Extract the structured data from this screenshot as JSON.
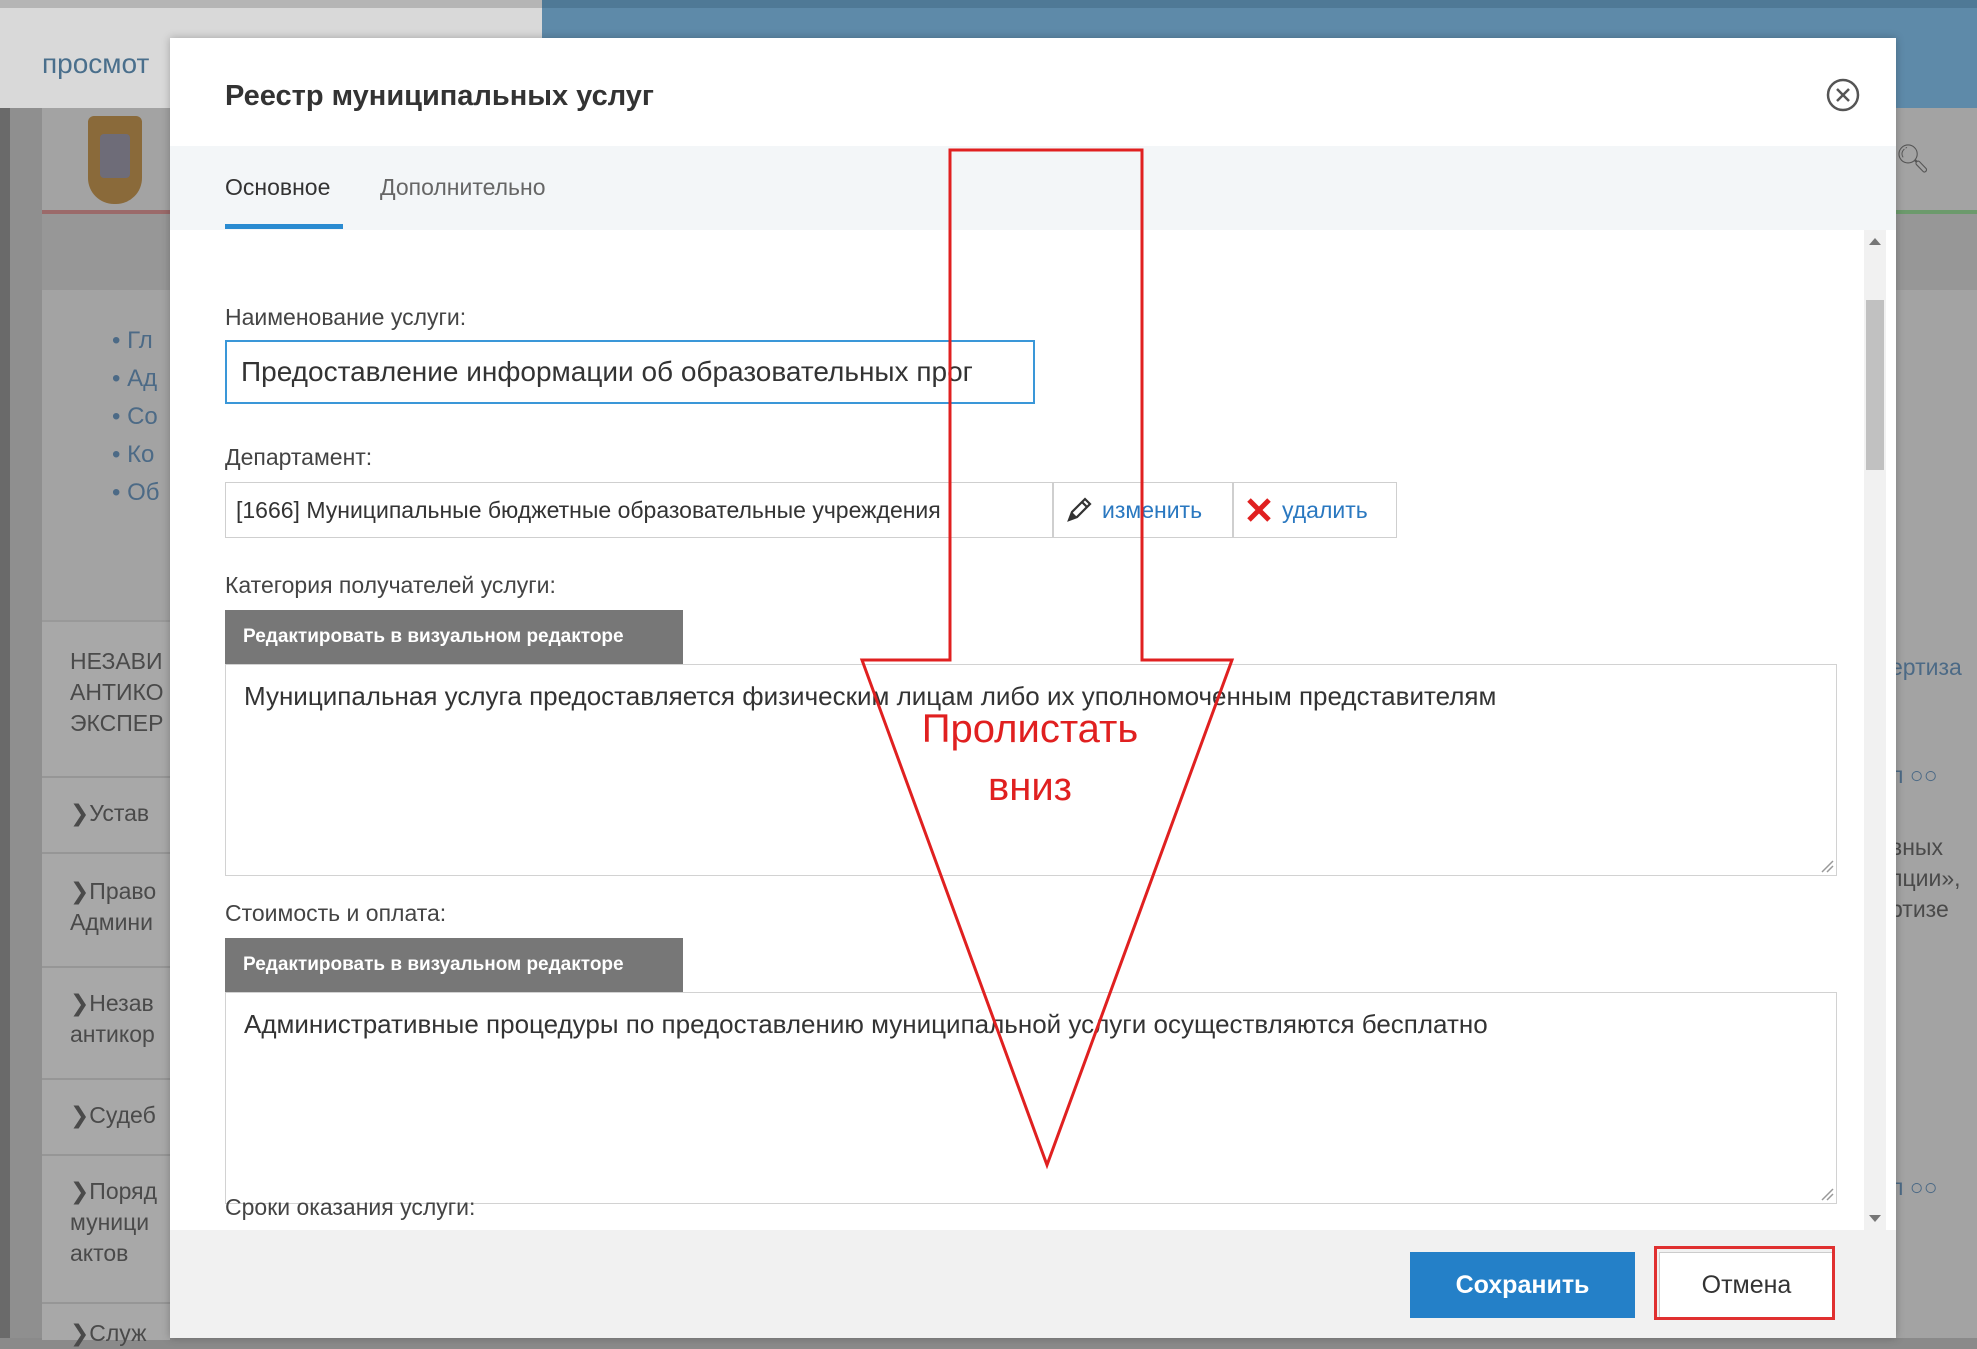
{
  "background": {
    "topbar_text": "просмот",
    "left_bullets": [
      "Гл",
      "Ад",
      "Со",
      "Ко",
      "Об"
    ],
    "left_panel_heading": [
      "НЕЗАВИ",
      "АНТИКО",
      "ЭКСПЕР"
    ],
    "left_items": [
      "Устав",
      "Право",
      "Админи",
      "Незав",
      "антикор",
      "Судеб",
      "Поряд",
      "муници",
      "актов",
      "Служ"
    ],
    "right_texts": {
      "heading": "ертиза",
      "toolbar1": "л  ○○",
      "lines": [
        "вных",
        "пции»,",
        "ртизе"
      ],
      "toolbar2": "л  ○○"
    }
  },
  "modal": {
    "title": "Реестр муниципальных услуг",
    "tabs": [
      {
        "label": "Основное",
        "active": true
      },
      {
        "label": "Дополнительно",
        "active": false
      }
    ],
    "fields": {
      "service_name_label": "Наименование услуги:",
      "service_name_value": "Предоставление информации об образовательных прог",
      "department_label": "Департамент:",
      "department_value": "[1666] Муниципальные бюджетные образовательные учреждения",
      "department_change": "изменить",
      "department_delete": "удалить",
      "recipients_label": "Категория получателей услуги:",
      "visual_editor_label": "Редактировать в визуальном редакторе",
      "recipients_value": "Муниципальная услуга предоставляется физическим лицам  либо их уполномоченным представителям",
      "cost_label": "Стоимость и оплата:",
      "cost_value": "Административные процедуры по предоставлению муниципальной услуги осуществляются бесплатно",
      "terms_label": "Сроки оказания услуги:"
    },
    "footer": {
      "save_label": "Сохранить",
      "cancel_label": "Отмена"
    }
  },
  "annotation": {
    "text_line1": "Пролистать",
    "text_line2": "вниз"
  },
  "colors": {
    "accent": "#2480c8",
    "annotation": "#e02020",
    "editor_button": "#777777"
  }
}
